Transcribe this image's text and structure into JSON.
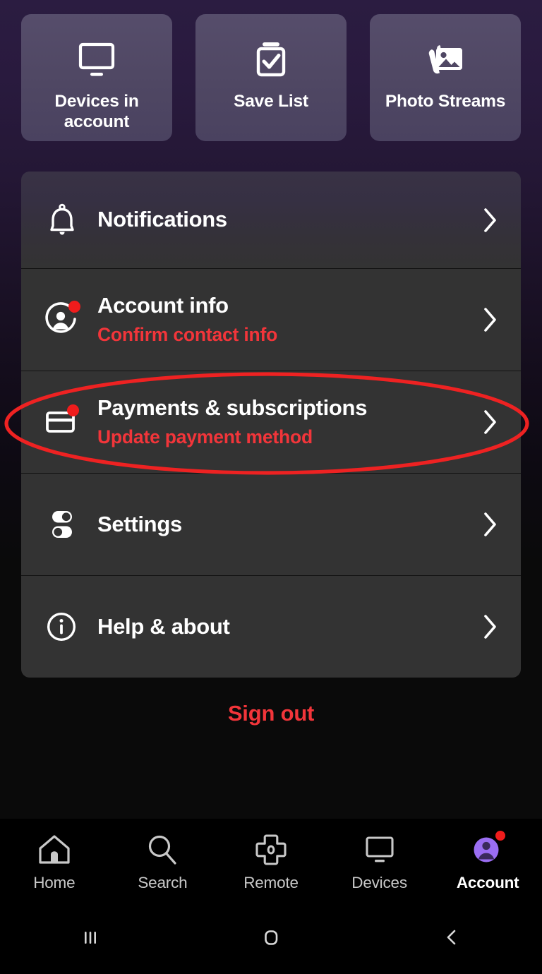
{
  "quick_actions": [
    {
      "label": "Devices in account",
      "icon": "monitor-icon"
    },
    {
      "label": "Save List",
      "icon": "clipboard-check-icon"
    },
    {
      "label": "Photo Streams",
      "icon": "photo-stack-icon"
    }
  ],
  "menu": [
    {
      "title": "Notifications",
      "subtitle": "",
      "icon": "bell-icon",
      "badge": false
    },
    {
      "title": "Account info",
      "subtitle": "Confirm contact info",
      "icon": "account-circle-icon",
      "badge": true
    },
    {
      "title": "Payments & subscriptions",
      "subtitle": "Update payment method",
      "icon": "credit-card-icon",
      "badge": true
    },
    {
      "title": "Settings",
      "subtitle": "",
      "icon": "sliders-icon",
      "badge": false
    },
    {
      "title": "Help & about",
      "subtitle": "",
      "icon": "info-circle-icon",
      "badge": false
    }
  ],
  "sign_out_label": "Sign out",
  "tabs": [
    {
      "label": "Home",
      "icon": "home-icon",
      "active": false,
      "badge": false
    },
    {
      "label": "Search",
      "icon": "search-icon",
      "active": false,
      "badge": false
    },
    {
      "label": "Remote",
      "icon": "remote-dpad-icon",
      "active": false,
      "badge": false
    },
    {
      "label": "Devices",
      "icon": "monitor-icon",
      "active": false,
      "badge": false
    },
    {
      "label": "Account",
      "icon": "account-avatar-icon",
      "active": true,
      "badge": true
    }
  ],
  "system_nav": [
    {
      "name": "recents-button",
      "icon": "recents-icon"
    },
    {
      "name": "home-button",
      "icon": "home-square-icon"
    },
    {
      "name": "back-button",
      "icon": "back-chevron-icon"
    }
  ],
  "annotation": {
    "type": "ellipse-highlight",
    "target": "Payments & subscriptions",
    "color": "#ee2222"
  },
  "colors": {
    "accent_red": "#f2353a",
    "badge_red": "#f01c1c",
    "card_purple": "#4f4763",
    "row_gray": "#333333",
    "active_tab_purple": "#9b6ef3",
    "annotation_red": "#ee2222"
  }
}
